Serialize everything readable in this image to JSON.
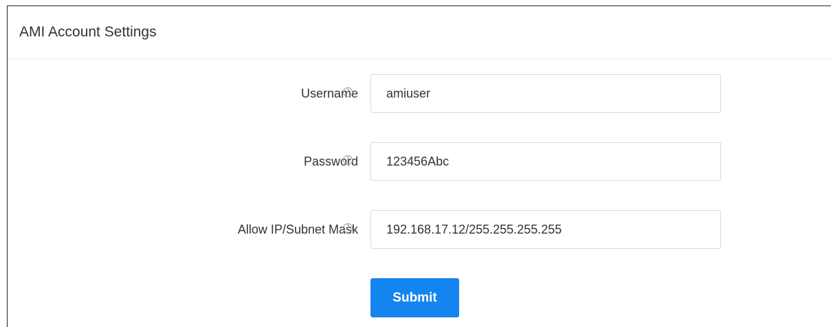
{
  "panel": {
    "title": "AMI Account Settings"
  },
  "form": {
    "username": {
      "label": "Username",
      "value": "amiuser",
      "help_icon": "question-circle-icon"
    },
    "password": {
      "label": "Password",
      "value": "123456Abc",
      "help_icon": "question-circle-icon"
    },
    "allow_ip": {
      "label": "Allow IP/Subnet Mask",
      "value": "192.168.17.12/255.255.255.255",
      "help_icon": "question-circle-icon"
    },
    "submit_label": "Submit"
  },
  "colors": {
    "accent": "#1485ee",
    "border": "#d9d9d9",
    "text": "#333333"
  }
}
